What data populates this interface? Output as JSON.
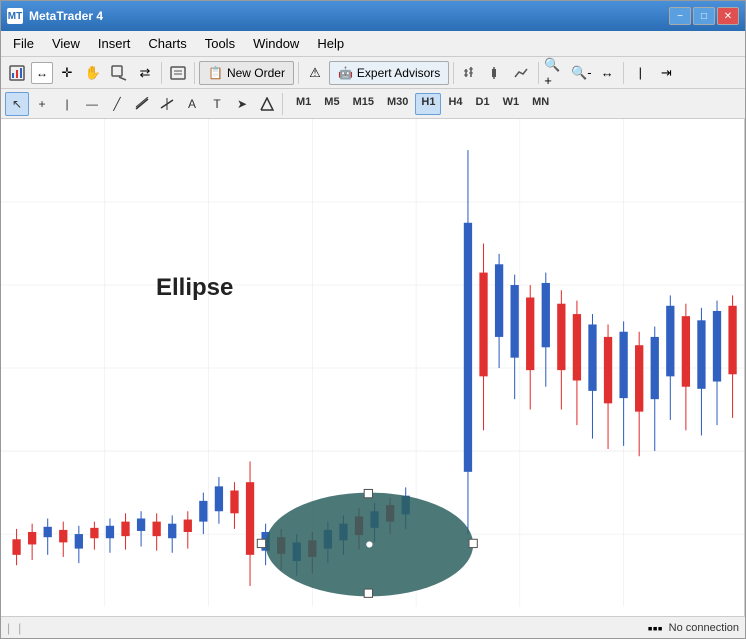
{
  "window": {
    "title": "MetaTrader 4"
  },
  "title_bar": {
    "title": "MetaTrader 4",
    "minimize_label": "−",
    "maximize_label": "□",
    "close_label": "✕"
  },
  "menu": {
    "items": [
      "File",
      "View",
      "Insert",
      "Charts",
      "Tools",
      "Window",
      "Help"
    ]
  },
  "toolbar1": {
    "new_order_label": "New Order",
    "expert_advisors_label": "Expert Advisors"
  },
  "toolbar2": {
    "timeframes": [
      "M1",
      "M5",
      "M15",
      "M30",
      "H1",
      "H4",
      "D1",
      "W1",
      "MN"
    ],
    "active_timeframe": "H1"
  },
  "chart": {
    "ellipse_label": "Ellipse"
  },
  "status_bar": {
    "no_connection_label": "No connection"
  },
  "colors": {
    "bull_candle": "#3060c0",
    "bear_candle": "#e03030",
    "ellipse_fill": "#2d6060",
    "chart_bg": "#ffffff"
  }
}
